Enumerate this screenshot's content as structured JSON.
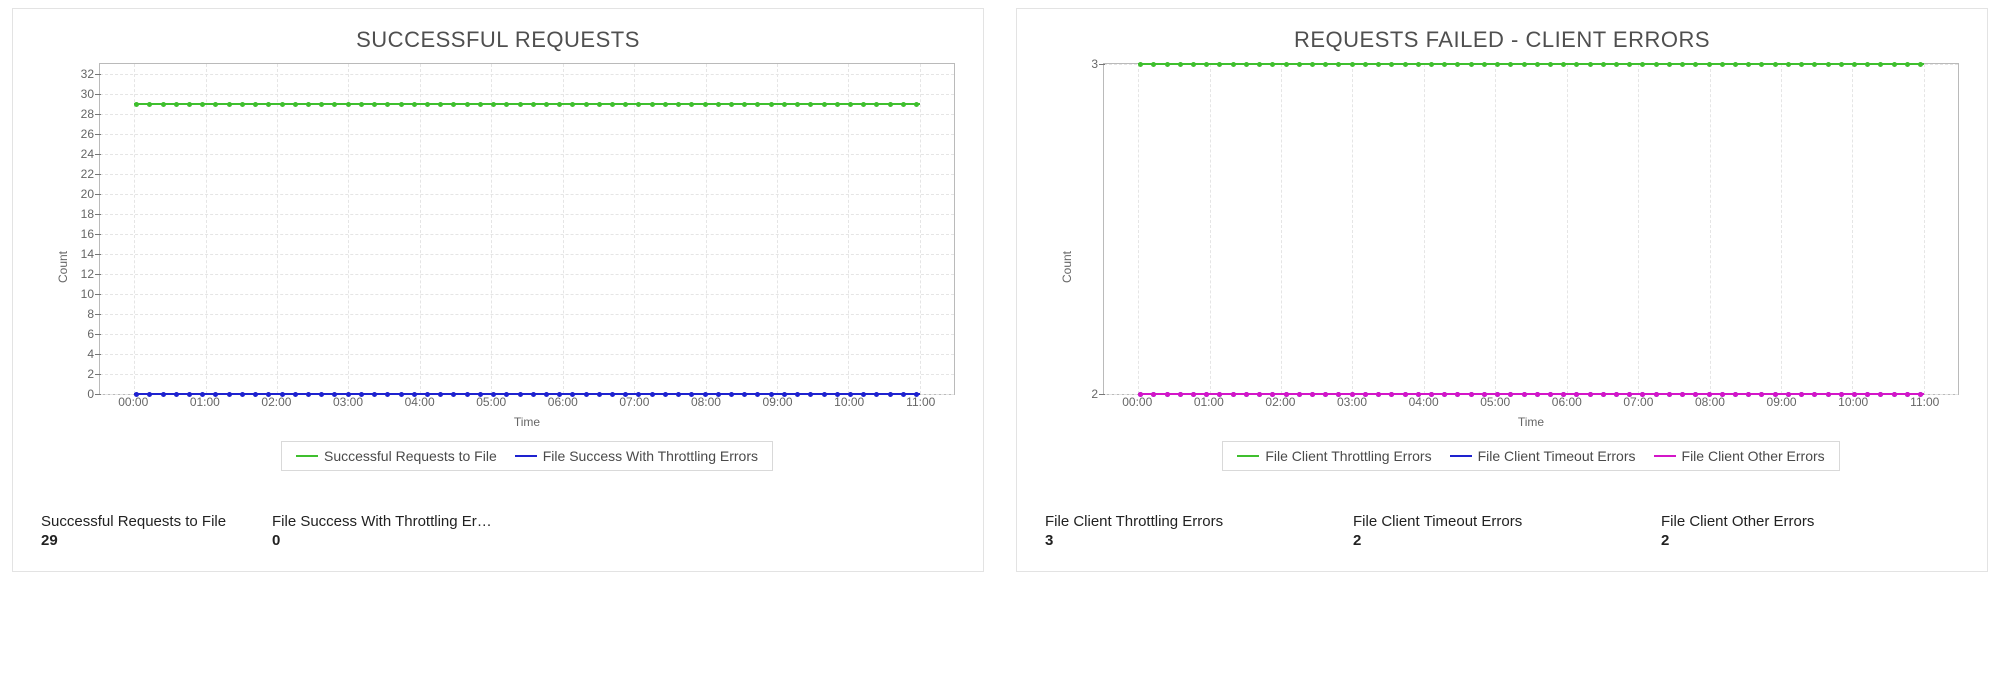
{
  "colors": {
    "green": "#3fbf2e",
    "blue": "#1e22cf",
    "magenta": "#d316c8"
  },
  "panels": [
    {
      "title": "SUCCESSFUL REQUESTS",
      "summary": [
        {
          "label": "Successful Requests to File",
          "value": "29"
        },
        {
          "label": "File Success With Throttling Errors. .",
          "value": "0"
        }
      ]
    },
    {
      "title": "REQUESTS FAILED - CLIENT ERRORS",
      "summary": [
        {
          "label": "File Client Throttling Errors",
          "value": "3"
        },
        {
          "label": "File Client Timeout Errors",
          "value": "2"
        },
        {
          "label": "File Client Other Errors",
          "value": "2"
        }
      ]
    }
  ],
  "chart_data": [
    {
      "type": "line",
      "title": "SUCCESSFUL REQUESTS",
      "xlabel": "Time",
      "ylabel": "Count",
      "ylim": [
        0,
        33
      ],
      "yticks": [
        0,
        2,
        4,
        6,
        8,
        10,
        12,
        14,
        16,
        18,
        20,
        22,
        24,
        26,
        28,
        30,
        32
      ],
      "categories": [
        "00:00",
        "01:00",
        "02:00",
        "03:00",
        "04:00",
        "05:00",
        "06:00",
        "07:00",
        "08:00",
        "09:00",
        "10:00",
        "11:00"
      ],
      "series": [
        {
          "name": "Successful Requests to File",
          "color": "green",
          "values": [
            29,
            29,
            29,
            29,
            29,
            29,
            29,
            29,
            29,
            29,
            29,
            29
          ]
        },
        {
          "name": "File Success With Throttling Errors",
          "color": "blue",
          "values": [
            0,
            0,
            0,
            0,
            0,
            0,
            0,
            0,
            0,
            0,
            0,
            0
          ]
        }
      ]
    },
    {
      "type": "line",
      "title": "REQUESTS FAILED - CLIENT ERRORS",
      "xlabel": "Time",
      "ylabel": "Count",
      "ylim": [
        2,
        3
      ],
      "yticks": [
        2,
        3
      ],
      "categories": [
        "00:00",
        "01:00",
        "02:00",
        "03:00",
        "04:00",
        "05:00",
        "06:00",
        "07:00",
        "08:00",
        "09:00",
        "10:00",
        "11:00"
      ],
      "series": [
        {
          "name": "File Client Throttling Errors",
          "color": "green",
          "values": [
            3,
            3,
            3,
            3,
            3,
            3,
            3,
            3,
            3,
            3,
            3,
            3
          ]
        },
        {
          "name": "File Client Timeout Errors",
          "color": "blue",
          "values": [
            2,
            2,
            2,
            2,
            2,
            2,
            2,
            2,
            2,
            2,
            2,
            2
          ]
        },
        {
          "name": "File Client Other Errors",
          "color": "magenta",
          "values": [
            2,
            2,
            2,
            2,
            2,
            2,
            2,
            2,
            2,
            2,
            2,
            2
          ]
        }
      ]
    }
  ]
}
